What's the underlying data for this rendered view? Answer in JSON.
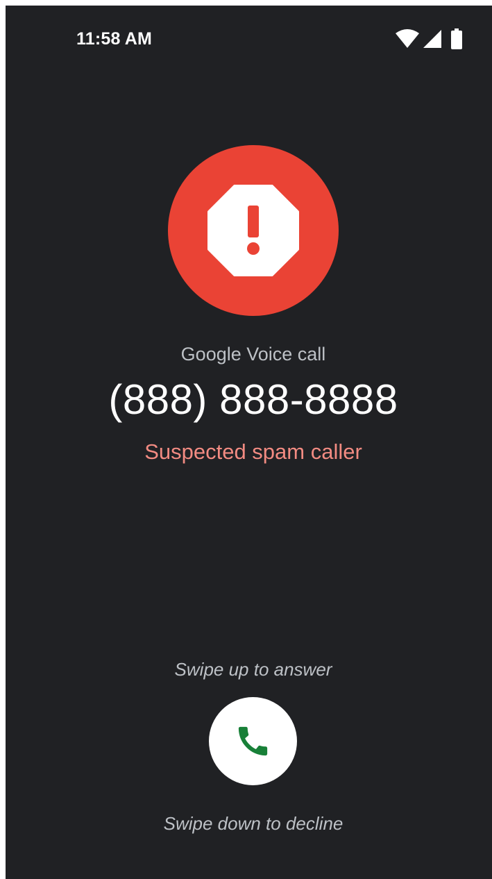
{
  "status_bar": {
    "time": "11:58 AM",
    "icons": [
      "wifi-icon",
      "signal-icon",
      "battery-icon"
    ]
  },
  "caller": {
    "spam_icon": "spam-warning-icon",
    "call_type": "Google Voice call",
    "number": "(888) 888-8888",
    "spam_label": "Suspected spam caller"
  },
  "actions": {
    "swipe_up_hint": "Swipe up to answer",
    "answer_icon": "phone-icon",
    "swipe_down_hint": "Swipe down to decline"
  },
  "colors": {
    "background": "#202124",
    "spam_red": "#ea4335",
    "spam_text": "#f28b82",
    "answer_green": "#188038"
  }
}
